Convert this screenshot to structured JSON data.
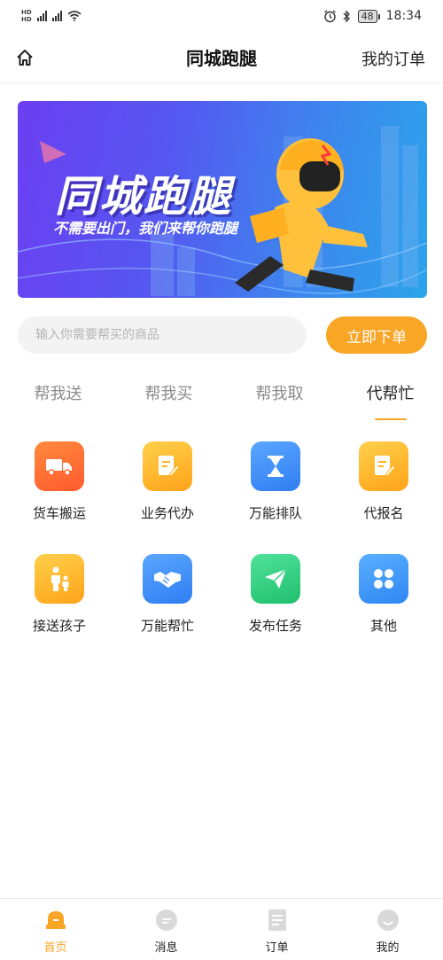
{
  "status_bar": {
    "network_labels": [
      "HD",
      "HD"
    ],
    "network_type": "4G",
    "battery": "48",
    "time": "18:34",
    "icons": [
      "signal-icon",
      "wifi-icon",
      "alarm-icon",
      "bluetooth-icon",
      "battery-icon"
    ]
  },
  "header": {
    "title": "同城跑腿",
    "right_link": "我的订单",
    "home_icon": "home-icon"
  },
  "banner": {
    "title": "同城跑腿",
    "subtitle": "不需要出门，我们来帮你跑腿"
  },
  "search": {
    "placeholder": "输入你需要帮买的商品",
    "value": "",
    "button_label": "立即下单"
  },
  "tabs": [
    {
      "label": "帮我送",
      "active": false
    },
    {
      "label": "帮我买",
      "active": false
    },
    {
      "label": "帮我取",
      "active": false
    },
    {
      "label": "代帮忙",
      "active": true
    }
  ],
  "services": [
    {
      "label": "货车搬运",
      "icon": "truck-icon",
      "color": "#ff6a33"
    },
    {
      "label": "业务代办",
      "icon": "document-edit-icon",
      "color": "#ffb41f"
    },
    {
      "label": "万能排队",
      "icon": "hourglass-icon",
      "color": "#3d8ef7"
    },
    {
      "label": "代报名",
      "icon": "document-edit-icon",
      "color": "#ffb41f"
    },
    {
      "label": "接送孩子",
      "icon": "parent-child-icon",
      "color": "#ffb41f"
    },
    {
      "label": "万能帮忙",
      "icon": "handshake-icon",
      "color": "#3d8ef7"
    },
    {
      "label": "发布任务",
      "icon": "paper-plane-icon",
      "color": "#2fcf7e"
    },
    {
      "label": "其他",
      "icon": "grid-dots-icon",
      "color": "#3d9af7"
    }
  ],
  "bottom_nav": [
    {
      "label": "首页",
      "icon": "home-bell-icon",
      "active": true
    },
    {
      "label": "消息",
      "icon": "message-icon",
      "active": false
    },
    {
      "label": "订单",
      "icon": "order-list-icon",
      "active": false
    },
    {
      "label": "我的",
      "icon": "profile-icon",
      "active": false
    }
  ],
  "colors": {
    "accent": "#f9a526",
    "banner_purple": "#6b3ff2",
    "banner_blue": "#2ba4ea",
    "inactive_tab": "#8a8a8a",
    "nav_inactive_icon": "#d6d6d6"
  }
}
